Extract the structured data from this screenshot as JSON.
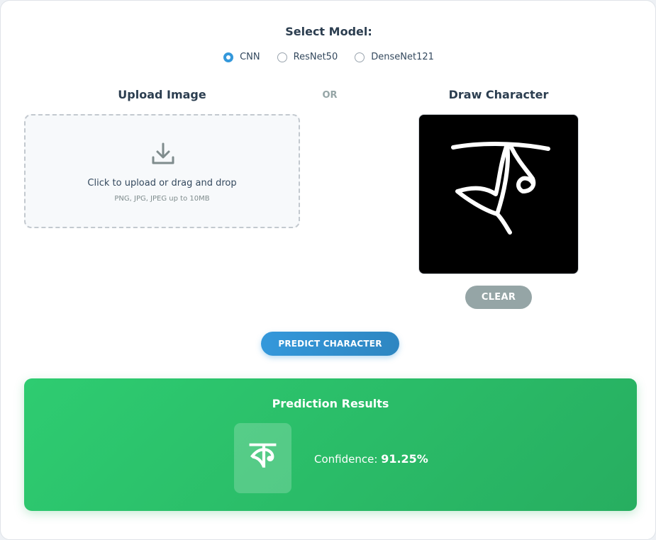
{
  "model_select": {
    "title": "Select Model:",
    "options": [
      {
        "label": "CNN",
        "checked": true
      },
      {
        "label": "ResNet50",
        "checked": false
      },
      {
        "label": "DenseNet121",
        "checked": false
      }
    ]
  },
  "upload": {
    "title": "Upload Image",
    "main_text": "Click to upload or drag and drop",
    "sub_text": "PNG, JPG, JPEG up to 10MB",
    "icon": "download-icon"
  },
  "or_label": "OR",
  "draw": {
    "title": "Draw Character",
    "clear_label": "CLEAR"
  },
  "predict_label": "PREDICT CHARACTER",
  "results": {
    "title": "Prediction Results",
    "character": "ক",
    "confidence_label": "Confidence:",
    "confidence_value": "91.25%"
  },
  "colors": {
    "accent": "#3498db",
    "results_bg": "#2ecc71",
    "clear_button": "#95a5a6"
  }
}
